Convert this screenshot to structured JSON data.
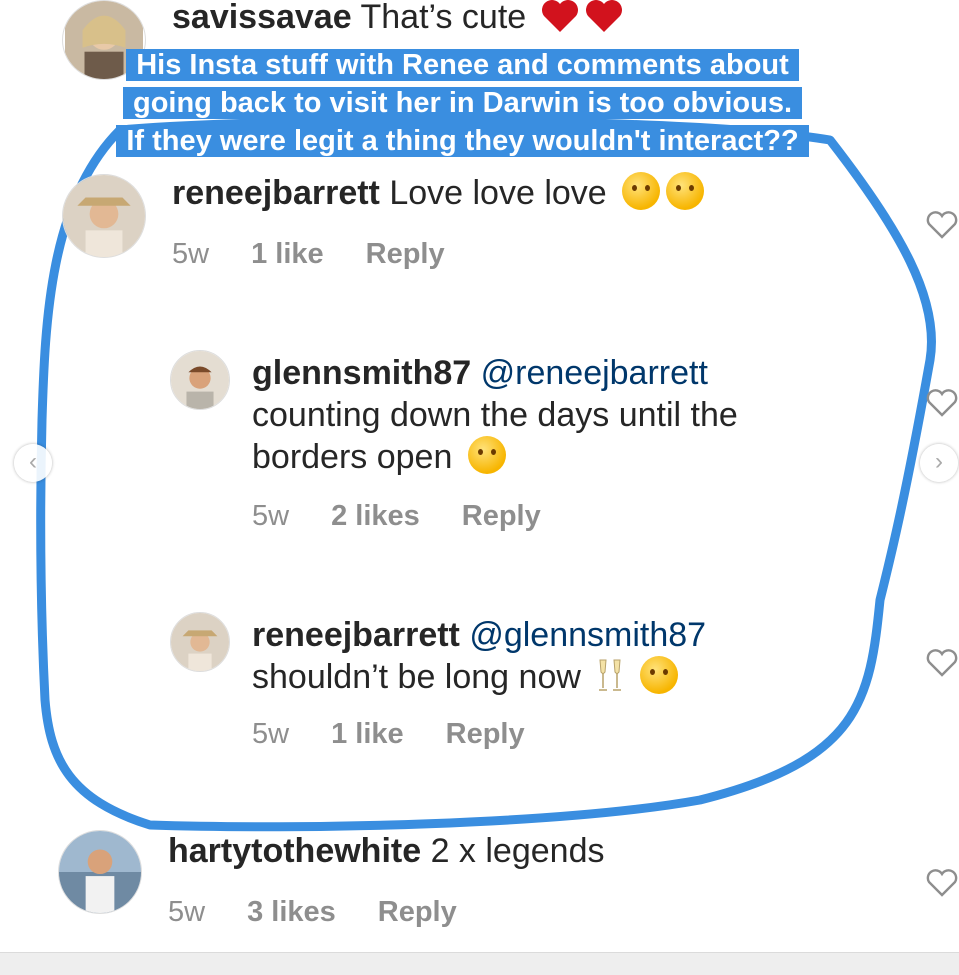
{
  "top_comment": {
    "username": "savissavae",
    "text": "That’s cute"
  },
  "caption": {
    "line1": "His Insta stuff with Renee and comments about",
    "line2": "going back to visit her in Darwin is too obvious.",
    "line3": "If they were legit a thing they wouldn't interact??"
  },
  "comments": [
    {
      "username": "reneejbarrett",
      "text": "Love love love",
      "time": "5w",
      "likes": "1 like",
      "reply": "Reply"
    },
    {
      "username": "glennsmith87",
      "mention": "@reneejbarrett",
      "text1": "counting down the days until the",
      "text2": "borders open",
      "time": "5w",
      "likes": "2 likes",
      "reply": "Reply"
    },
    {
      "username": "reneejbarrett",
      "mention": "@glennsmith87",
      "text1": "shouldn’t be long now",
      "time": "5w",
      "likes": "1 like",
      "reply": "Reply"
    },
    {
      "username": "hartytothewhite",
      "text": "2 x legends",
      "time": "5w",
      "likes": "3 likes",
      "reply": "Reply"
    }
  ],
  "colors": {
    "highlight": "#3a8ee0",
    "meta": "#8e8e8e",
    "mention": "#00376b"
  }
}
